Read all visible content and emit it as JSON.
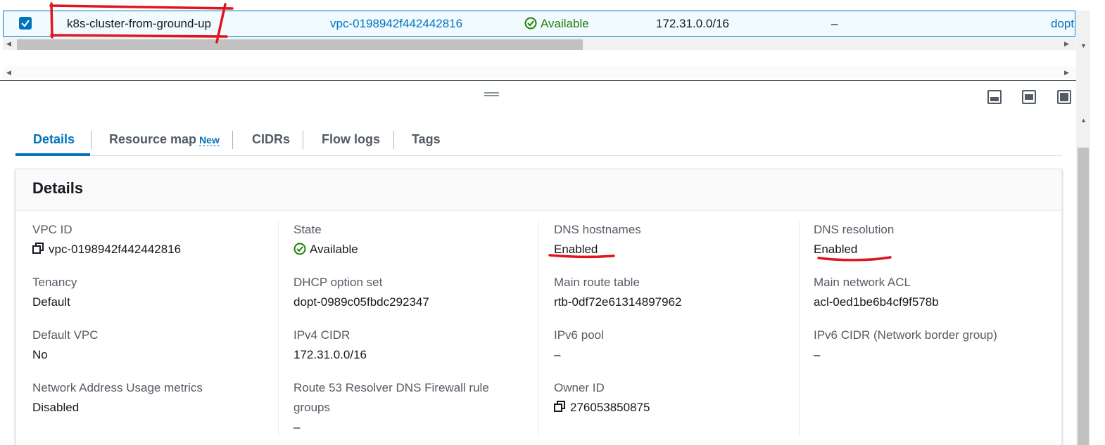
{
  "table_row": {
    "name": "k8s-cluster-from-ground-up",
    "vpc_id": "vpc-0198942f442442816",
    "state": "Available",
    "ipv4_cidr": "172.31.0.0/16",
    "ipv6_cidr": "–",
    "dhcp_option_set_truncated": "dopt"
  },
  "tabs": [
    {
      "label": "Details"
    },
    {
      "label": "Resource map",
      "badge": "New"
    },
    {
      "label": "CIDRs"
    },
    {
      "label": "Flow logs"
    },
    {
      "label": "Tags"
    }
  ],
  "details": {
    "title": "Details",
    "fields": {
      "vpc_id": {
        "label": "VPC ID",
        "value": "vpc-0198942f442442816"
      },
      "state": {
        "label": "State",
        "value": "Available"
      },
      "dns_hostnames": {
        "label": "DNS hostnames",
        "value": "Enabled"
      },
      "dns_resolution": {
        "label": "DNS resolution",
        "value": "Enabled"
      },
      "tenancy": {
        "label": "Tenancy",
        "value": "Default"
      },
      "dhcp_option_set": {
        "label": "DHCP option set",
        "value": "dopt-0989c05fbdc292347"
      },
      "main_route_table": {
        "label": "Main route table",
        "value": "rtb-0df72e61314897962"
      },
      "main_network_acl": {
        "label": "Main network ACL",
        "value": "acl-0ed1be6b4cf9f578b"
      },
      "default_vpc": {
        "label": "Default VPC",
        "value": "No"
      },
      "ipv4_cidr": {
        "label": "IPv4 CIDR",
        "value": "172.31.0.0/16"
      },
      "ipv6_pool": {
        "label": "IPv6 pool",
        "value": "–"
      },
      "ipv6_cidr": {
        "label": "IPv6 CIDR (Network border group)",
        "value": "–"
      },
      "nau_metrics": {
        "label": "Network Address Usage metrics",
        "value": "Disabled"
      },
      "route53_firewall": {
        "label_line1": "Route 53 Resolver DNS Firewall rule",
        "label_line2": "groups",
        "value": "–"
      },
      "owner_id": {
        "label": "Owner ID",
        "value": "276053850875"
      }
    }
  },
  "colors": {
    "link": "#0073bb",
    "success": "#1d8102",
    "annotation": "#e0141e"
  }
}
